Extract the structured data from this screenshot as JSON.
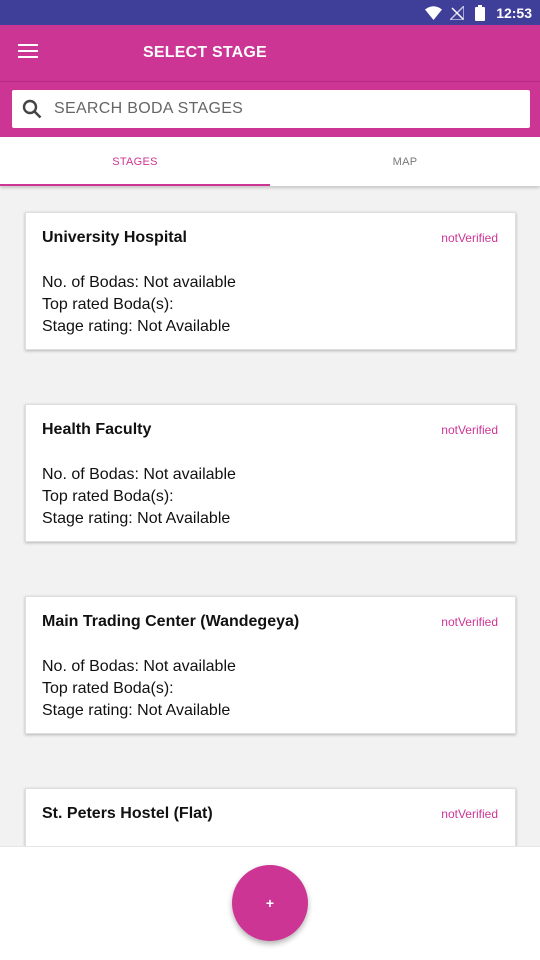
{
  "status_bar": {
    "time": "12:53",
    "icons": [
      "wifi-icon",
      "no-signal-icon",
      "battery-icon"
    ]
  },
  "app_bar": {
    "menu_icon": "menu-icon",
    "title": "SELECT STAGE",
    "color": "#cd3595"
  },
  "search": {
    "icon": "search-icon",
    "placeholder": "SEARCH BODA STAGES",
    "value": ""
  },
  "tabs": [
    {
      "label": "STAGES",
      "active": true
    },
    {
      "label": "MAP",
      "active": false
    }
  ],
  "stages": [
    {
      "name": "University Hospital",
      "status": "notVerified",
      "bodas": "No. of Bodas: Not available",
      "top_rated": "Top rated Boda(s):",
      "rating": "Stage rating: Not Available"
    },
    {
      "name": "Health Faculty",
      "status": "notVerified",
      "bodas": "No. of Bodas: Not available",
      "top_rated": "Top rated Boda(s):",
      "rating": "Stage rating: Not Available"
    },
    {
      "name": "Main Trading Center (Wandegeya)",
      "status": "notVerified",
      "bodas": "No. of Bodas: Not available",
      "top_rated": "Top rated Boda(s):",
      "rating": "Stage rating: Not Available"
    },
    {
      "name": "St. Peters Hostel (Flat)",
      "status": "notVerified"
    }
  ],
  "fab": {
    "label": "+"
  }
}
